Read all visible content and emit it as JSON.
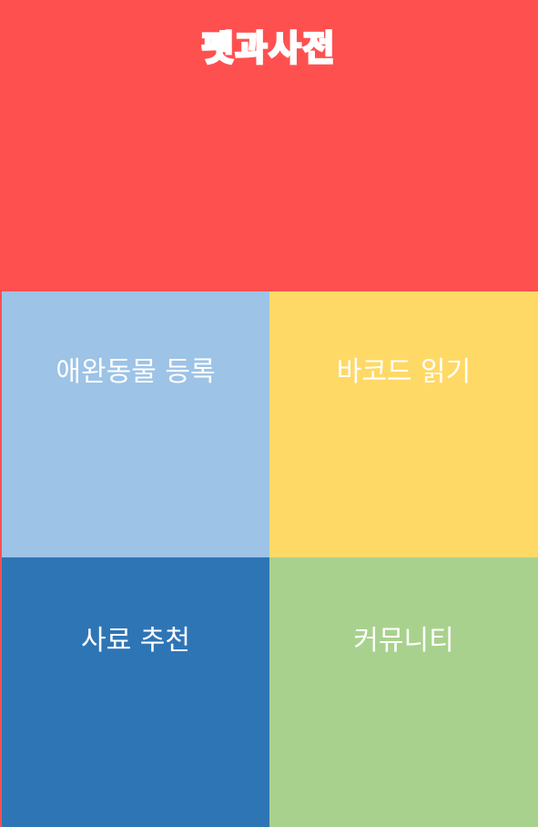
{
  "app": {
    "title": "펫과사전"
  },
  "colors": {
    "header": "#FF5050",
    "tile_register": "#9DC3E6",
    "tile_barcode": "#FFD966",
    "tile_feed": "#2E75B6",
    "tile_community": "#A9D18E",
    "label_text": "#FFFFFF"
  },
  "menu": {
    "items": [
      {
        "label": "애완동물 등록"
      },
      {
        "label": "바코드 읽기"
      },
      {
        "label": "사료 추천"
      },
      {
        "label": "커뮤니티"
      }
    ]
  }
}
